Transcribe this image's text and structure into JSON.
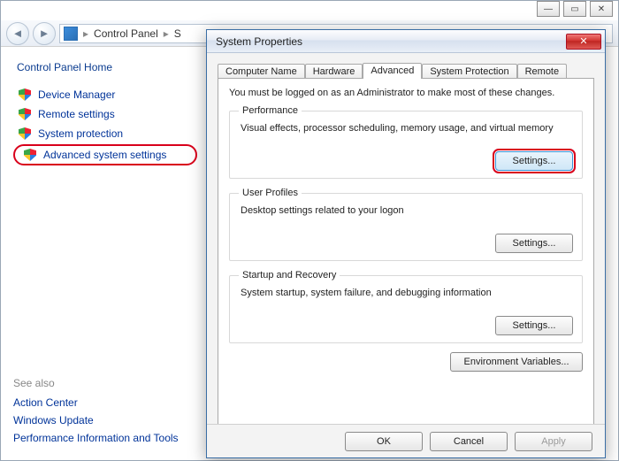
{
  "window_controls": {
    "min": "—",
    "max": "▭",
    "close": "✕"
  },
  "breadcrumb": {
    "root": "Control Panel",
    "next": "S",
    "sep": "▸"
  },
  "sidebar": {
    "heading": "Control Panel Home",
    "links": [
      {
        "label": "Device Manager"
      },
      {
        "label": "Remote settings"
      },
      {
        "label": "System protection"
      },
      {
        "label": "Advanced system settings"
      }
    ],
    "see_also_heading": "See also",
    "see_also": [
      "Action Center",
      "Windows Update",
      "Performance Information and Tools"
    ]
  },
  "dialog": {
    "title": "System Properties",
    "tabs": [
      "Computer Name",
      "Hardware",
      "Advanced",
      "System Protection",
      "Remote"
    ],
    "active_tab_index": 2,
    "admin_note": "You must be logged on as an Administrator to make most of these changes.",
    "groups": {
      "performance": {
        "legend": "Performance",
        "desc": "Visual effects, processor scheduling, memory usage, and virtual memory",
        "button": "Settings..."
      },
      "user_profiles": {
        "legend": "User Profiles",
        "desc": "Desktop settings related to your logon",
        "button": "Settings..."
      },
      "startup": {
        "legend": "Startup and Recovery",
        "desc": "System startup, system failure, and debugging information",
        "button": "Settings..."
      }
    },
    "env_button": "Environment Variables...",
    "footer": {
      "ok": "OK",
      "cancel": "Cancel",
      "apply": "Apply"
    }
  }
}
